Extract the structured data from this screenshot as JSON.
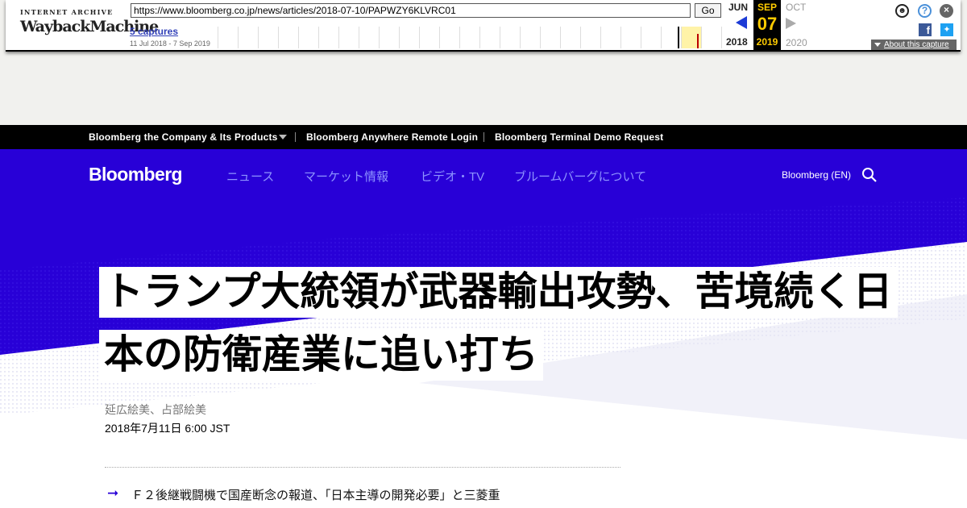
{
  "wayback": {
    "logo_top": "INTERNET ARCHIVE",
    "logo_main": "WaybackMachine",
    "url": "https://www.bloomberg.co.jp/news/articles/2018-07-10/PAPWZY6KLVRC01",
    "go_label": "Go",
    "captures_label": "5 captures",
    "capture_range": "11 Jul 2018 - 7 Sep 2019",
    "prev_month": "JUN",
    "prev_year": "2018",
    "current_month": "SEP",
    "current_day": "07",
    "current_year": "2019",
    "next_month": "OCT",
    "next_year": "2020",
    "about_label": "About this capture",
    "accent_color": "#ffcc00"
  },
  "corp_bar": {
    "items": [
      "Bloomberg the Company & Its Products",
      "Bloomberg Anywhere Remote Login",
      "Bloomberg Terminal Demo Request"
    ]
  },
  "header": {
    "brand": "Bloomberg",
    "nav": [
      "ニュース",
      "マーケット情報",
      "ビデオ・TV",
      "ブルームバーグについて"
    ],
    "edition": "Bloomberg (EN)",
    "background_color": "#2800d7"
  },
  "article": {
    "headline": "トランプ大統領が武器輸出攻勢、苦境続く日本の防衛産業に追い打ち",
    "authors": "延広絵美、占部絵美",
    "published": "2018年7月11日 6:00 JST",
    "related_bullet": "Ｆ２後継戦闘機で国産断念の報道、「日本主導の開発必要」と三菱重"
  }
}
